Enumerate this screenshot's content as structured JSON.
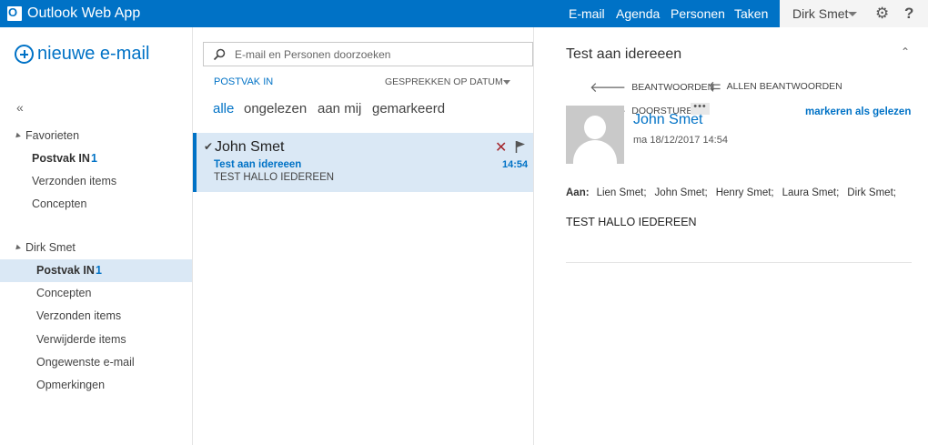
{
  "app": {
    "title": "Outlook Web App"
  },
  "topnav": {
    "items": [
      {
        "label": "E-mail"
      },
      {
        "label": "Agenda"
      },
      {
        "label": "Personen"
      },
      {
        "label": "Taken"
      }
    ],
    "user": "Dirk Smet",
    "icons": [
      "gear-icon",
      "help-icon"
    ]
  },
  "sidebar": {
    "new_mail": "nieuwe e-mail",
    "collapse": "«",
    "favorites_head": "Favorieten",
    "favorites": [
      {
        "label": "Postvak IN",
        "count": "1"
      },
      {
        "label": "Verzonden items",
        "count": ""
      },
      {
        "label": "Concepten",
        "count": ""
      }
    ],
    "account_head": "Dirk Smet",
    "folders": [
      {
        "label": "Postvak IN",
        "count": "1"
      },
      {
        "label": "Concepten",
        "count": ""
      },
      {
        "label": "Verzonden items",
        "count": ""
      },
      {
        "label": "Verwijderde items",
        "count": ""
      },
      {
        "label": "Ongewenste e-mail",
        "count": ""
      },
      {
        "label": "Opmerkingen",
        "count": ""
      }
    ]
  },
  "list": {
    "search_placeholder": "E-mail en Personen doorzoeken",
    "folder_label": "POSTVAK IN",
    "sort_label": "GESPREKKEN OP DATUM",
    "filters": [
      "alle",
      "ongelezen",
      "aan mij",
      "gemarkeerd"
    ],
    "messages": [
      {
        "sender": "John Smet",
        "subject": "Test aan idereeen",
        "preview": "TEST HALLO IEDEREEN",
        "time": "14:54"
      }
    ]
  },
  "reader": {
    "subject": "Test aan idereeen",
    "actions": {
      "reply": "BEANTWOORDEN",
      "reply_all": "ALLEN BEANTWOORDEN",
      "forward": "DOORSTUREN",
      "more": "•••"
    },
    "from": "John Smet",
    "date": "ma 18/12/2017 14:54",
    "mark_read": "markeren als gelezen",
    "to_label": "Aan:",
    "to": [
      "Lien Smet;",
      "John Smet;",
      "Henry Smet;",
      "Laura Smet;",
      "Dirk Smet;"
    ],
    "body": "TEST HALLO IEDEREEN"
  },
  "colors": {
    "brand": "#0072c6",
    "selected_bg": "#dae8f5",
    "delete": "#a4262c"
  }
}
